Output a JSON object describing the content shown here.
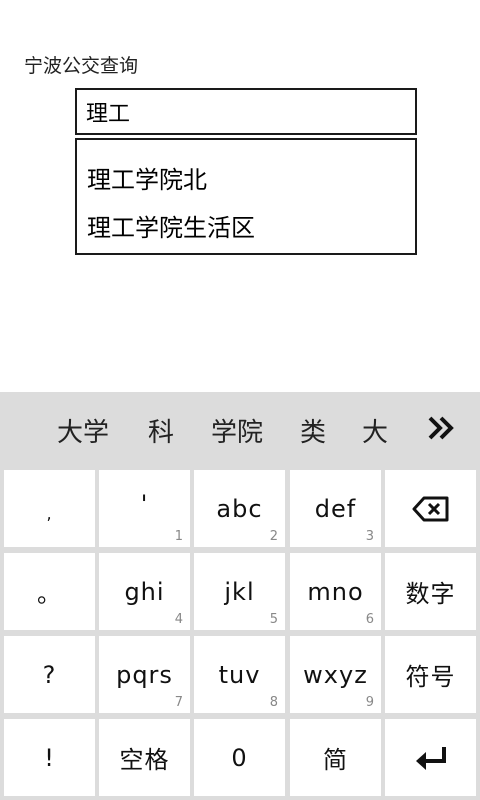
{
  "app": {
    "title": "宁波公交查询"
  },
  "search": {
    "value": "理工",
    "suggestions": [
      "理工学院北",
      "理工学院生活区"
    ]
  },
  "keyboard": {
    "candidates": [
      "大学",
      "科",
      "学院",
      "类",
      "大"
    ],
    "rows": [
      [
        {
          "label": ",",
          "num": ""
        },
        {
          "label": "'",
          "num": "1"
        },
        {
          "label": "abc",
          "num": "2"
        },
        {
          "label": "def",
          "num": "3"
        },
        {
          "label": "",
          "num": "",
          "icon": "backspace-icon"
        }
      ],
      [
        {
          "label": "。",
          "num": ""
        },
        {
          "label": "ghi",
          "num": "4"
        },
        {
          "label": "jkl",
          "num": "5"
        },
        {
          "label": "mno",
          "num": "6"
        },
        {
          "label": "数字",
          "num": ""
        }
      ],
      [
        {
          "label": "?",
          "num": ""
        },
        {
          "label": "pqrs",
          "num": "7"
        },
        {
          "label": "tuv",
          "num": "8"
        },
        {
          "label": "wxyz",
          "num": "9"
        },
        {
          "label": "符号",
          "num": ""
        }
      ],
      [
        {
          "label": "!",
          "num": ""
        },
        {
          "label": "空格",
          "num": ""
        },
        {
          "label": "0",
          "num": ""
        },
        {
          "label": "简",
          "num": ""
        },
        {
          "label": "",
          "num": "",
          "icon": "enter-icon"
        }
      ]
    ]
  }
}
